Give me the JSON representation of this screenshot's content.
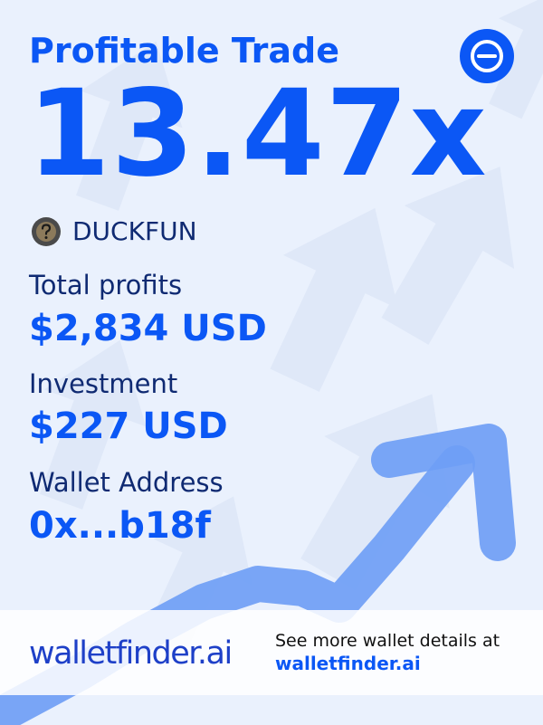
{
  "card": {
    "title": "Profitable Trade",
    "multiplier": "13.47x"
  },
  "token": {
    "name": "DUCKFUN",
    "icon": "question-mark-token-icon"
  },
  "chain_icon": "minus-circle-icon",
  "stats": {
    "total_profits_label": "Total profits",
    "total_profits_value": "$2,834 USD",
    "investment_label": "Investment",
    "investment_value": "$227 USD",
    "wallet_label": "Wallet Address",
    "wallet_value": "0x...b18f"
  },
  "footer": {
    "logo": "walletfinder.ai",
    "promo_text": "See more wallet details at",
    "promo_link": "walletfinder.ai"
  },
  "colors": {
    "accent": "#0b57f5",
    "dark_text": "#0f2a72",
    "background": "#eaf1fd",
    "arrow": "#6f9ef5"
  }
}
